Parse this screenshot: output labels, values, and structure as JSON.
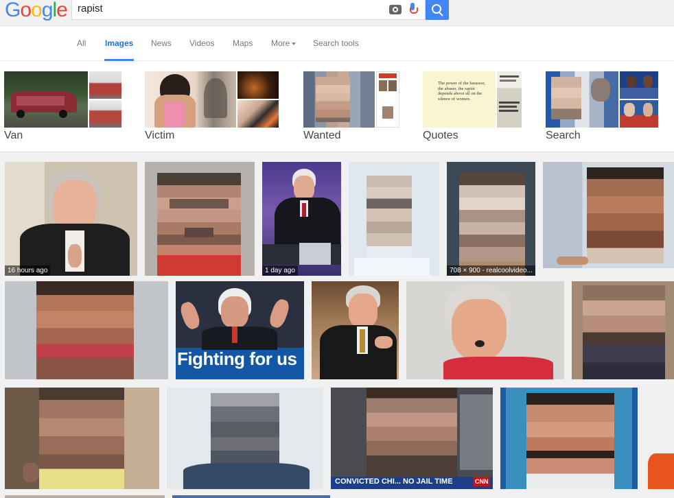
{
  "header": {
    "logo_letters": [
      {
        "ch": "G",
        "color": "#4285f4"
      },
      {
        "ch": "o",
        "color": "#ea4335"
      },
      {
        "ch": "o",
        "color": "#fbbc05"
      },
      {
        "ch": "g",
        "color": "#4285f4"
      },
      {
        "ch": "l",
        "color": "#34a853"
      },
      {
        "ch": "e",
        "color": "#ea4335"
      }
    ],
    "query": "rapist"
  },
  "tabs": [
    {
      "label": "All",
      "active": false
    },
    {
      "label": "Images",
      "active": true
    },
    {
      "label": "News",
      "active": false
    },
    {
      "label": "Videos",
      "active": false
    },
    {
      "label": "Maps",
      "active": false
    },
    {
      "label": "More",
      "active": false,
      "dropdown": true
    },
    {
      "label": "Search tools",
      "active": false
    }
  ],
  "related": [
    {
      "label": "Van"
    },
    {
      "label": "Victim"
    },
    {
      "label": "Wanted"
    },
    {
      "label": "Quotes",
      "quote_text": "The power of the harasser, the abuser, the rapist depends above all on the silence of women."
    },
    {
      "label": "Search"
    }
  ],
  "results": {
    "captions": {
      "r1_1": "16 hours ago",
      "r1_3": "1 day ago",
      "r1_5": "708 × 900 - realcoolvideo..."
    },
    "banners": {
      "fighting": "Fighting for us",
      "cnn": "CONVICTED CHI... NO JAIL TIME",
      "cnn_logo": "CNN"
    }
  }
}
